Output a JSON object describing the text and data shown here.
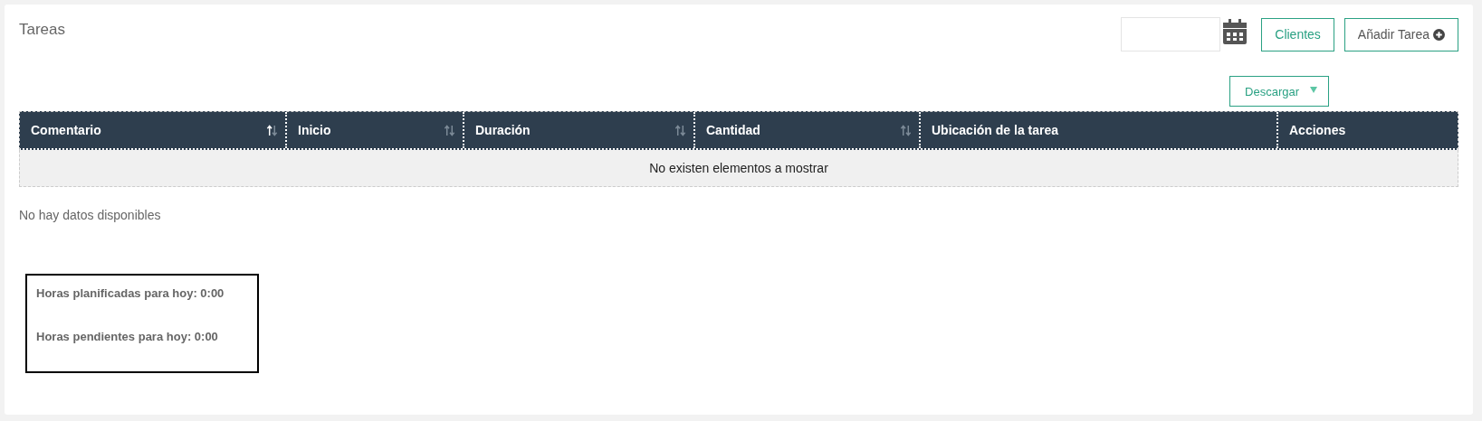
{
  "title": "Tareas",
  "toolbar": {
    "buttons": [
      {
        "label": "Clientes",
        "kind": "plain"
      },
      {
        "label": "Añadir Tarea",
        "kind": "add"
      }
    ]
  },
  "download_button": {
    "label": "Descargar"
  },
  "table": {
    "columns": [
      {
        "label": "Comentario",
        "sortable": true,
        "sorted": true
      },
      {
        "label": "Inicio",
        "sortable": true,
        "sorted": false
      },
      {
        "label": "Duración",
        "sortable": true,
        "sorted": false
      },
      {
        "label": "Cantidad",
        "sortable": true,
        "sorted": false
      },
      {
        "label": "Ubicación de la tarea",
        "sortable": false,
        "sorted": false
      },
      {
        "label": "Acciones",
        "sortable": false,
        "sorted": false
      }
    ],
    "empty_message": "No existen elementos a mostrar"
  },
  "no_data": "No hay datos disponibles",
  "summary": [
    "Horas planificadas para hoy: 0:00",
    "Horas pendientes para hoy: 0:00"
  ]
}
